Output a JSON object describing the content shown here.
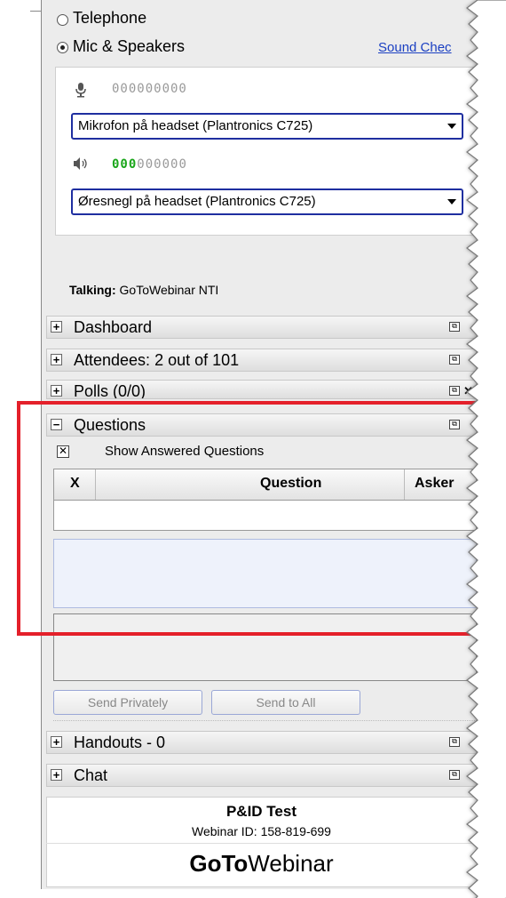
{
  "audio": {
    "telephone_label": "Telephone",
    "mic_label": "Mic & Speakers",
    "sound_check_link": "Sound Chec",
    "mic_meter": "000000000",
    "mic_device": "Mikrofon på headset (Plantronics C725)",
    "speaker_meter_on": "000",
    "speaker_meter_off": "000000",
    "speaker_device": "Øresnegl på headset (Plantronics C725)",
    "talking_label": "Talking:",
    "talking_name": "GoToWebinar NTI"
  },
  "panels": {
    "dashboard": "Dashboard",
    "attendees": "Attendees:  2 out of 101",
    "polls": "Polls (0/0)",
    "questions": "Questions",
    "handouts": "Handouts - 0",
    "chat": "Chat"
  },
  "questions": {
    "show_answered": "Show Answered Questions",
    "col_x": "X",
    "col_question": "Question",
    "col_asker": "Asker",
    "send_privately": "Send Privately",
    "send_to_all": "Send to All"
  },
  "footer": {
    "webinar_title": "P&ID Test",
    "webinar_id": "Webinar ID: 158-819-699",
    "brand_bold": "GoTo",
    "brand_light": "Webinar"
  },
  "icons": {
    "mic": "microphone-icon",
    "speaker": "speaker-icon",
    "popout": "popout-icon",
    "close": "close-icon"
  },
  "colors": {
    "highlight_box": "#e4202a",
    "link": "#1a3fc2",
    "meter_active": "#1aa61a",
    "select_border": "#1f2fa0"
  }
}
